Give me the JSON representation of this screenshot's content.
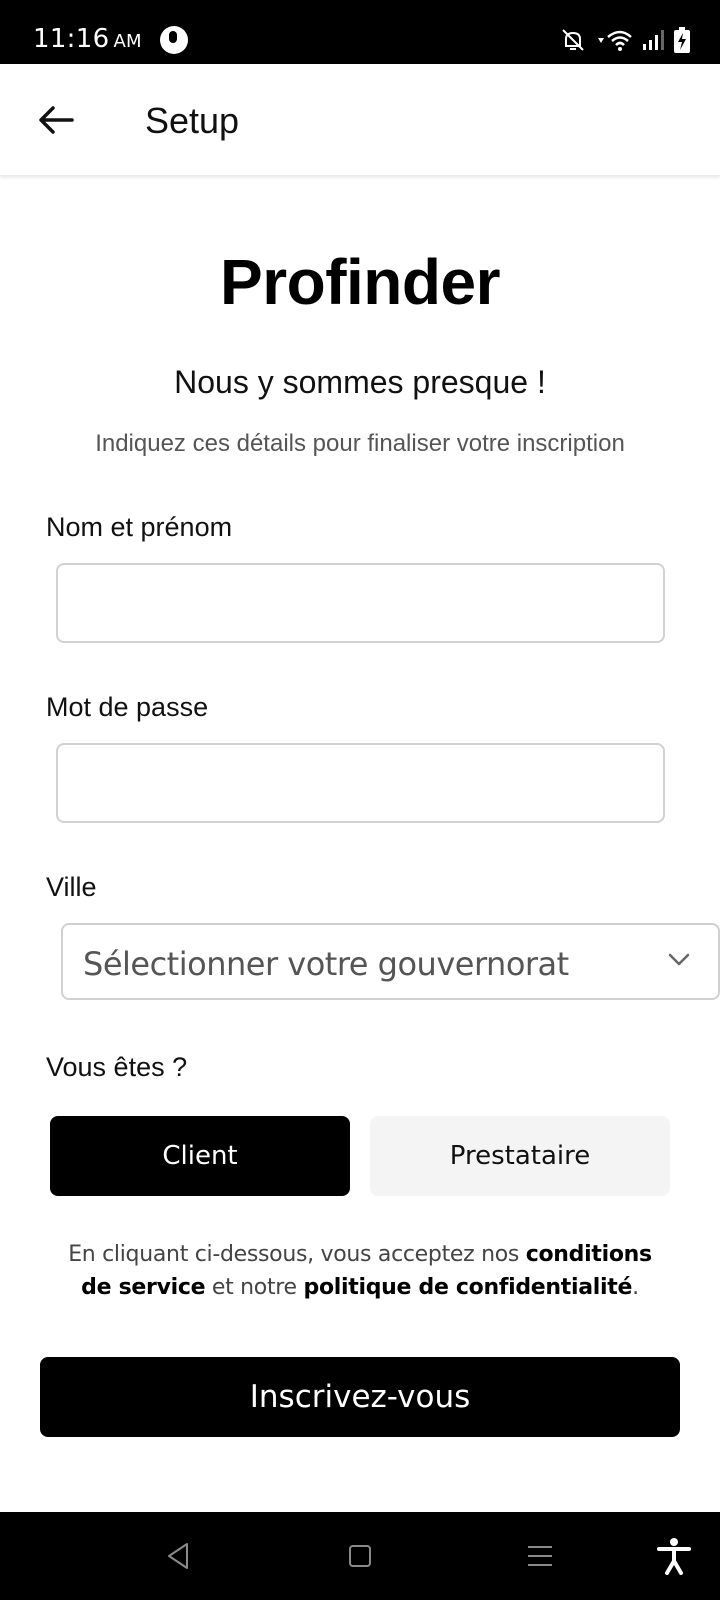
{
  "status_bar": {
    "time": "11:16",
    "ampm": "AM",
    "icons": [
      "app-notification-icon",
      "bell-off-icon",
      "wifi-icon",
      "signal-icon",
      "battery-charging-icon"
    ]
  },
  "app_bar": {
    "title": "Setup",
    "back_icon": "arrow-left-icon"
  },
  "brand": {
    "name": "Profinder"
  },
  "intro": {
    "subtitle": "Nous y sommes presque !",
    "description": "Indiquez ces détails pour finaliser votre inscription"
  },
  "form": {
    "name": {
      "label": "Nom et prénom",
      "value": ""
    },
    "password": {
      "label": "Mot de passe",
      "value": ""
    },
    "city": {
      "label": "Ville",
      "selected": "Sélectionner votre gouvernorat"
    },
    "role": {
      "label": "Vous êtes ?",
      "options": [
        "Client",
        "Prestataire"
      ],
      "selected": "Client"
    }
  },
  "terms": {
    "prefix": "En cliquant ci-dessous, vous acceptez nos ",
    "link_terms": "conditions de service",
    "middle": " et notre ",
    "link_privacy": "politique de confidentialité",
    "suffix": "."
  },
  "submit": {
    "label": "Inscrivez-vous"
  },
  "nav_bar": {
    "icons": [
      "back-triangle-icon",
      "home-square-icon",
      "menu-lines-icon",
      "accessibility-icon"
    ]
  },
  "colors": {
    "primary": "#000000",
    "secondary_button": "#f4f4f4",
    "border": "#d2d2d2",
    "muted_text": "#555555"
  }
}
